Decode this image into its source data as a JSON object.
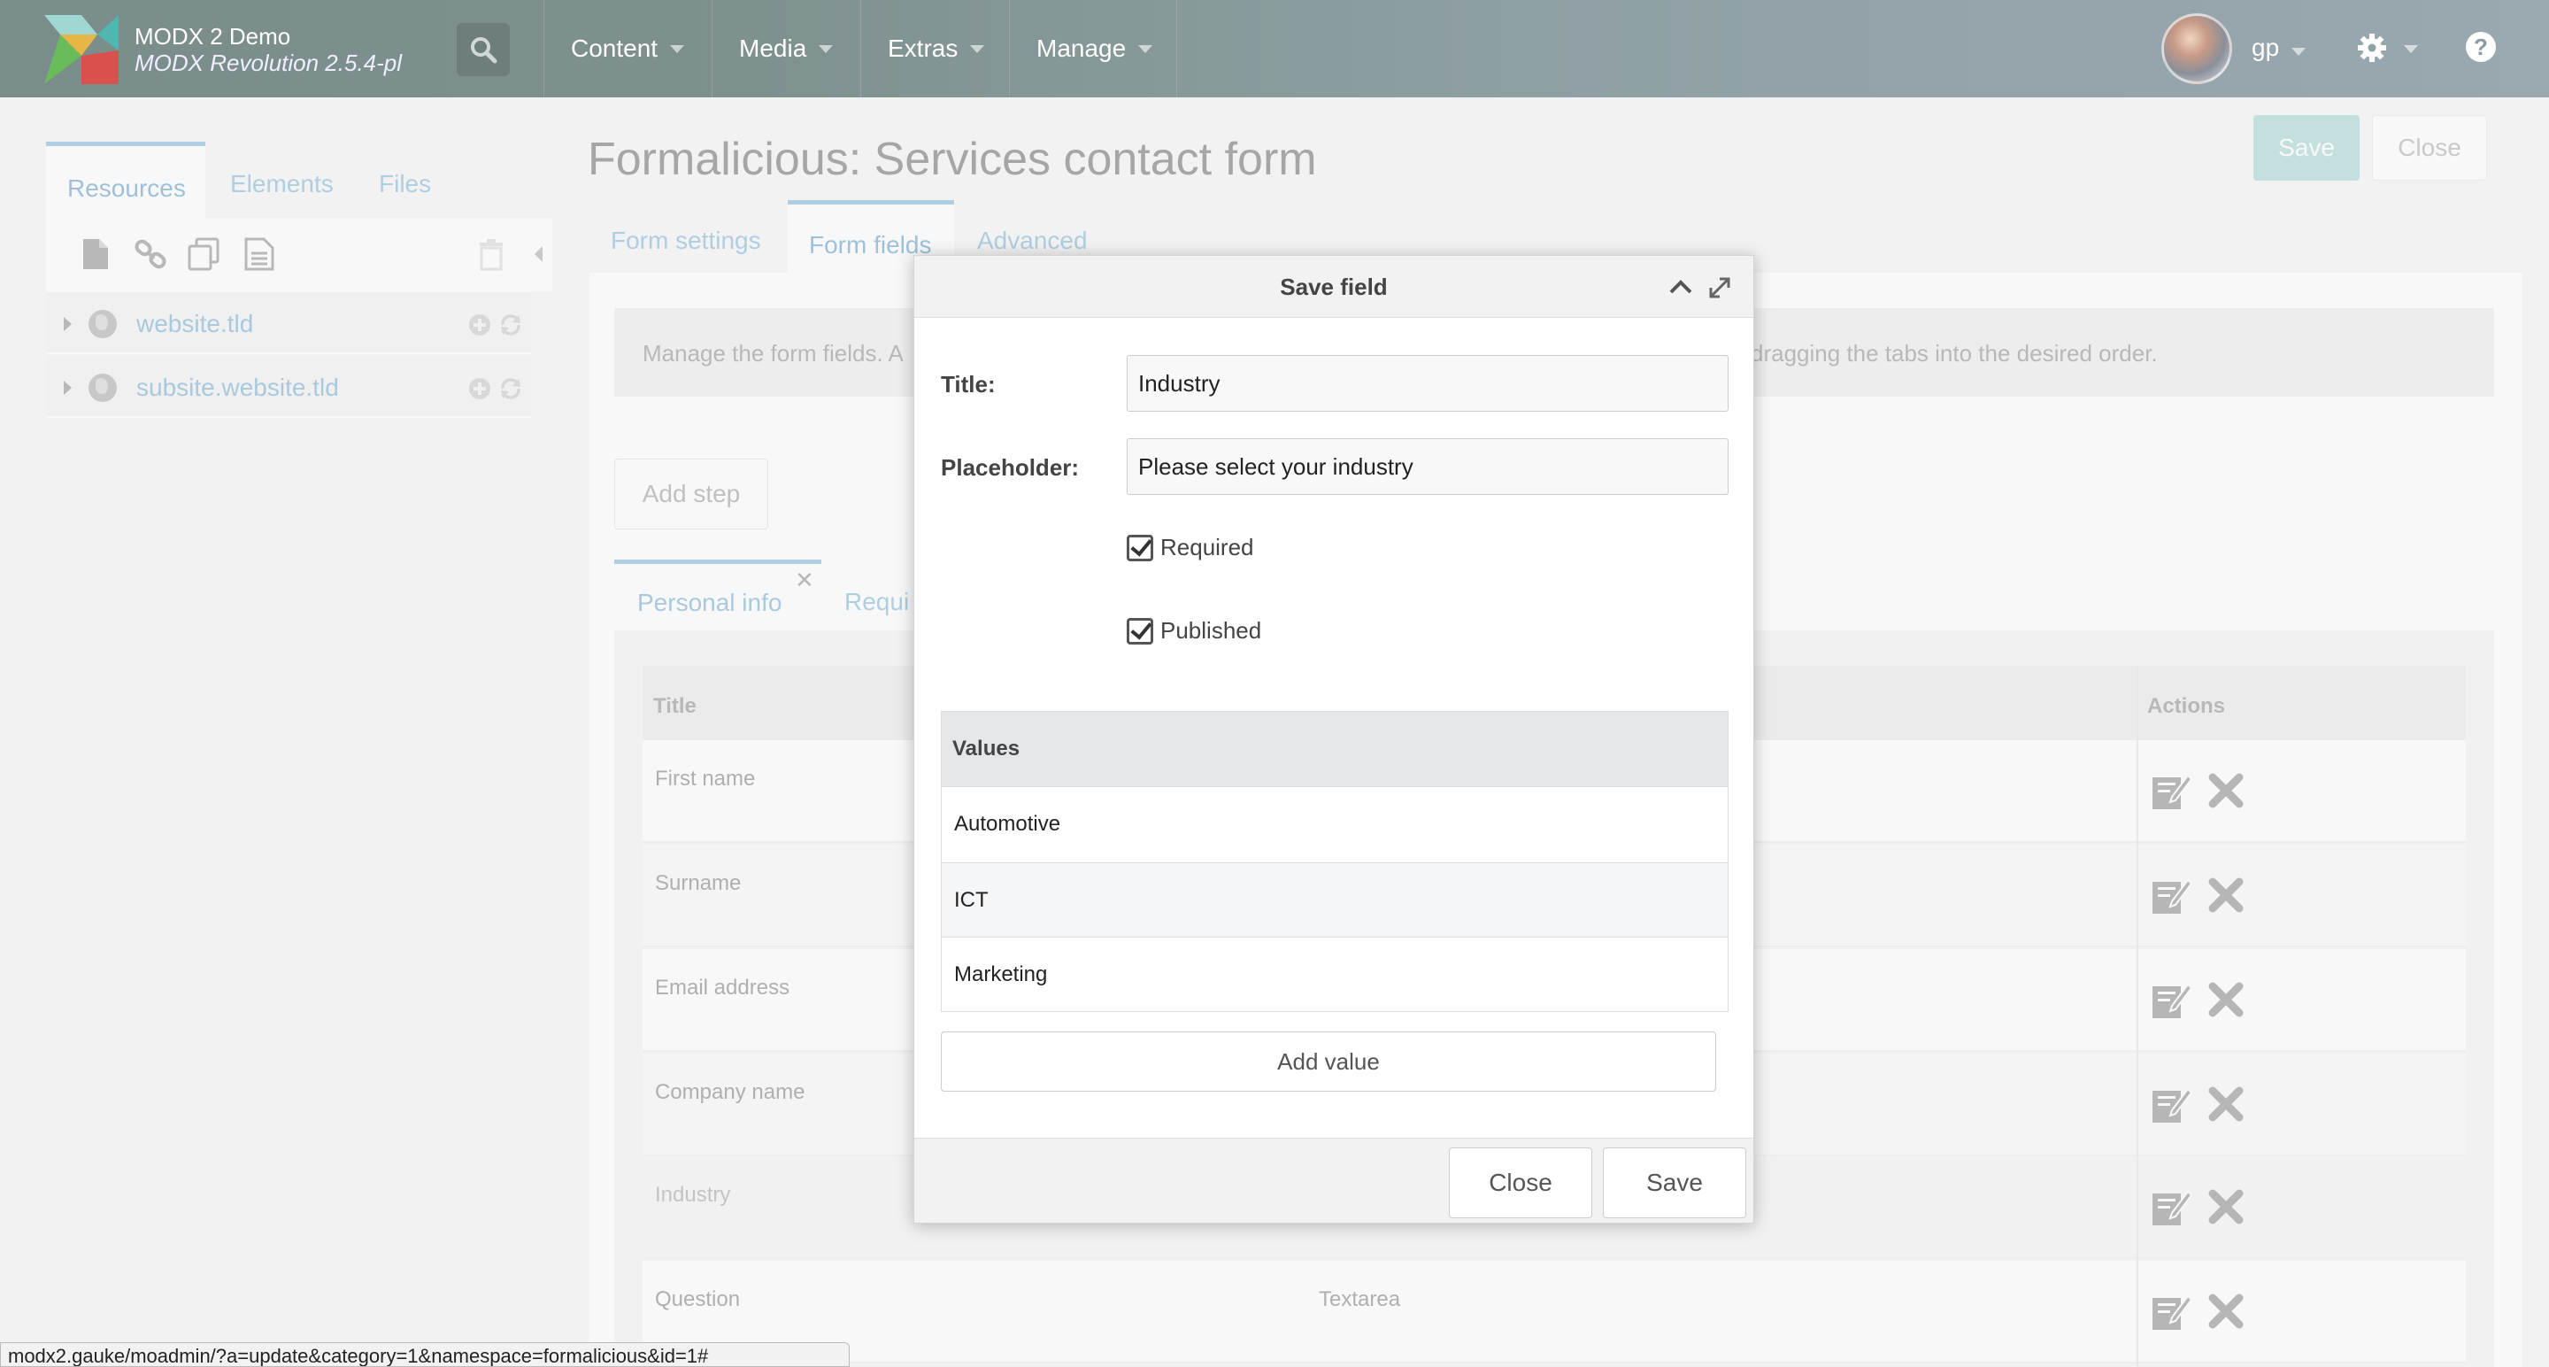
{
  "topbar": {
    "site_name": "MODX 2 Demo",
    "site_version": "MODX Revolution 2.5.4-pl",
    "menu": [
      {
        "label": "Content"
      },
      {
        "label": "Media"
      },
      {
        "label": "Extras"
      },
      {
        "label": "Manage"
      }
    ],
    "username": "gp",
    "help": "?",
    "icons": {
      "search": "search-icon",
      "gear": "gear-icon",
      "help": "help-icon",
      "logo": "modx-logo"
    }
  },
  "tree": {
    "tabs": [
      {
        "label": "Resources",
        "active": true
      },
      {
        "label": "Elements"
      },
      {
        "label": "Files"
      }
    ],
    "toolbar_icons": [
      "new-document-icon",
      "weblink-icon",
      "symlink-icon",
      "static-resource-icon",
      "trash-icon"
    ],
    "nodes": [
      {
        "label": "website.tld"
      },
      {
        "label": "subsite.website.tld"
      }
    ]
  },
  "page": {
    "title": "Formalicious: Services contact form",
    "save_label": "Save",
    "close_label": "Close",
    "save_color": "#9fd4cf",
    "tabs": [
      {
        "label": "Form settings"
      },
      {
        "label": "Form fields",
        "active": true
      },
      {
        "label": "Advanced"
      }
    ],
    "info_text": "Manage the form fields. A",
    "info_text_tail": "dragging the tabs into the desired order.",
    "add_step_label": "Add step",
    "step_tabs": [
      {
        "label": "Personal info",
        "active": true
      },
      {
        "label": "Requi"
      }
    ],
    "grid": {
      "columns": {
        "title": "Title",
        "actions": "Actions"
      },
      "rows": [
        {
          "title": "First name",
          "type": ""
        },
        {
          "title": "Surname",
          "type": ""
        },
        {
          "title": "Email address",
          "type": ""
        },
        {
          "title": "Company name",
          "type": ""
        },
        {
          "title": "Industry",
          "type": ""
        },
        {
          "title": "Question",
          "type": "Textarea"
        }
      ]
    }
  },
  "modal": {
    "title": "Save field",
    "title_label": "Title:",
    "title_value": "Industry",
    "placeholder_label": "Placeholder:",
    "placeholder_value": "Please select your industry",
    "required_label": "Required",
    "required_checked": true,
    "published_label": "Published",
    "published_checked": true,
    "values_header": "Values",
    "values": [
      "Automotive",
      "ICT",
      "Marketing"
    ],
    "add_value_label": "Add value",
    "close_label": "Close",
    "save_label": "Save"
  },
  "statusbar": {
    "url": "modx2.gauke/moadmin/?a=update&category=1&namespace=formalicious&id=1#"
  }
}
